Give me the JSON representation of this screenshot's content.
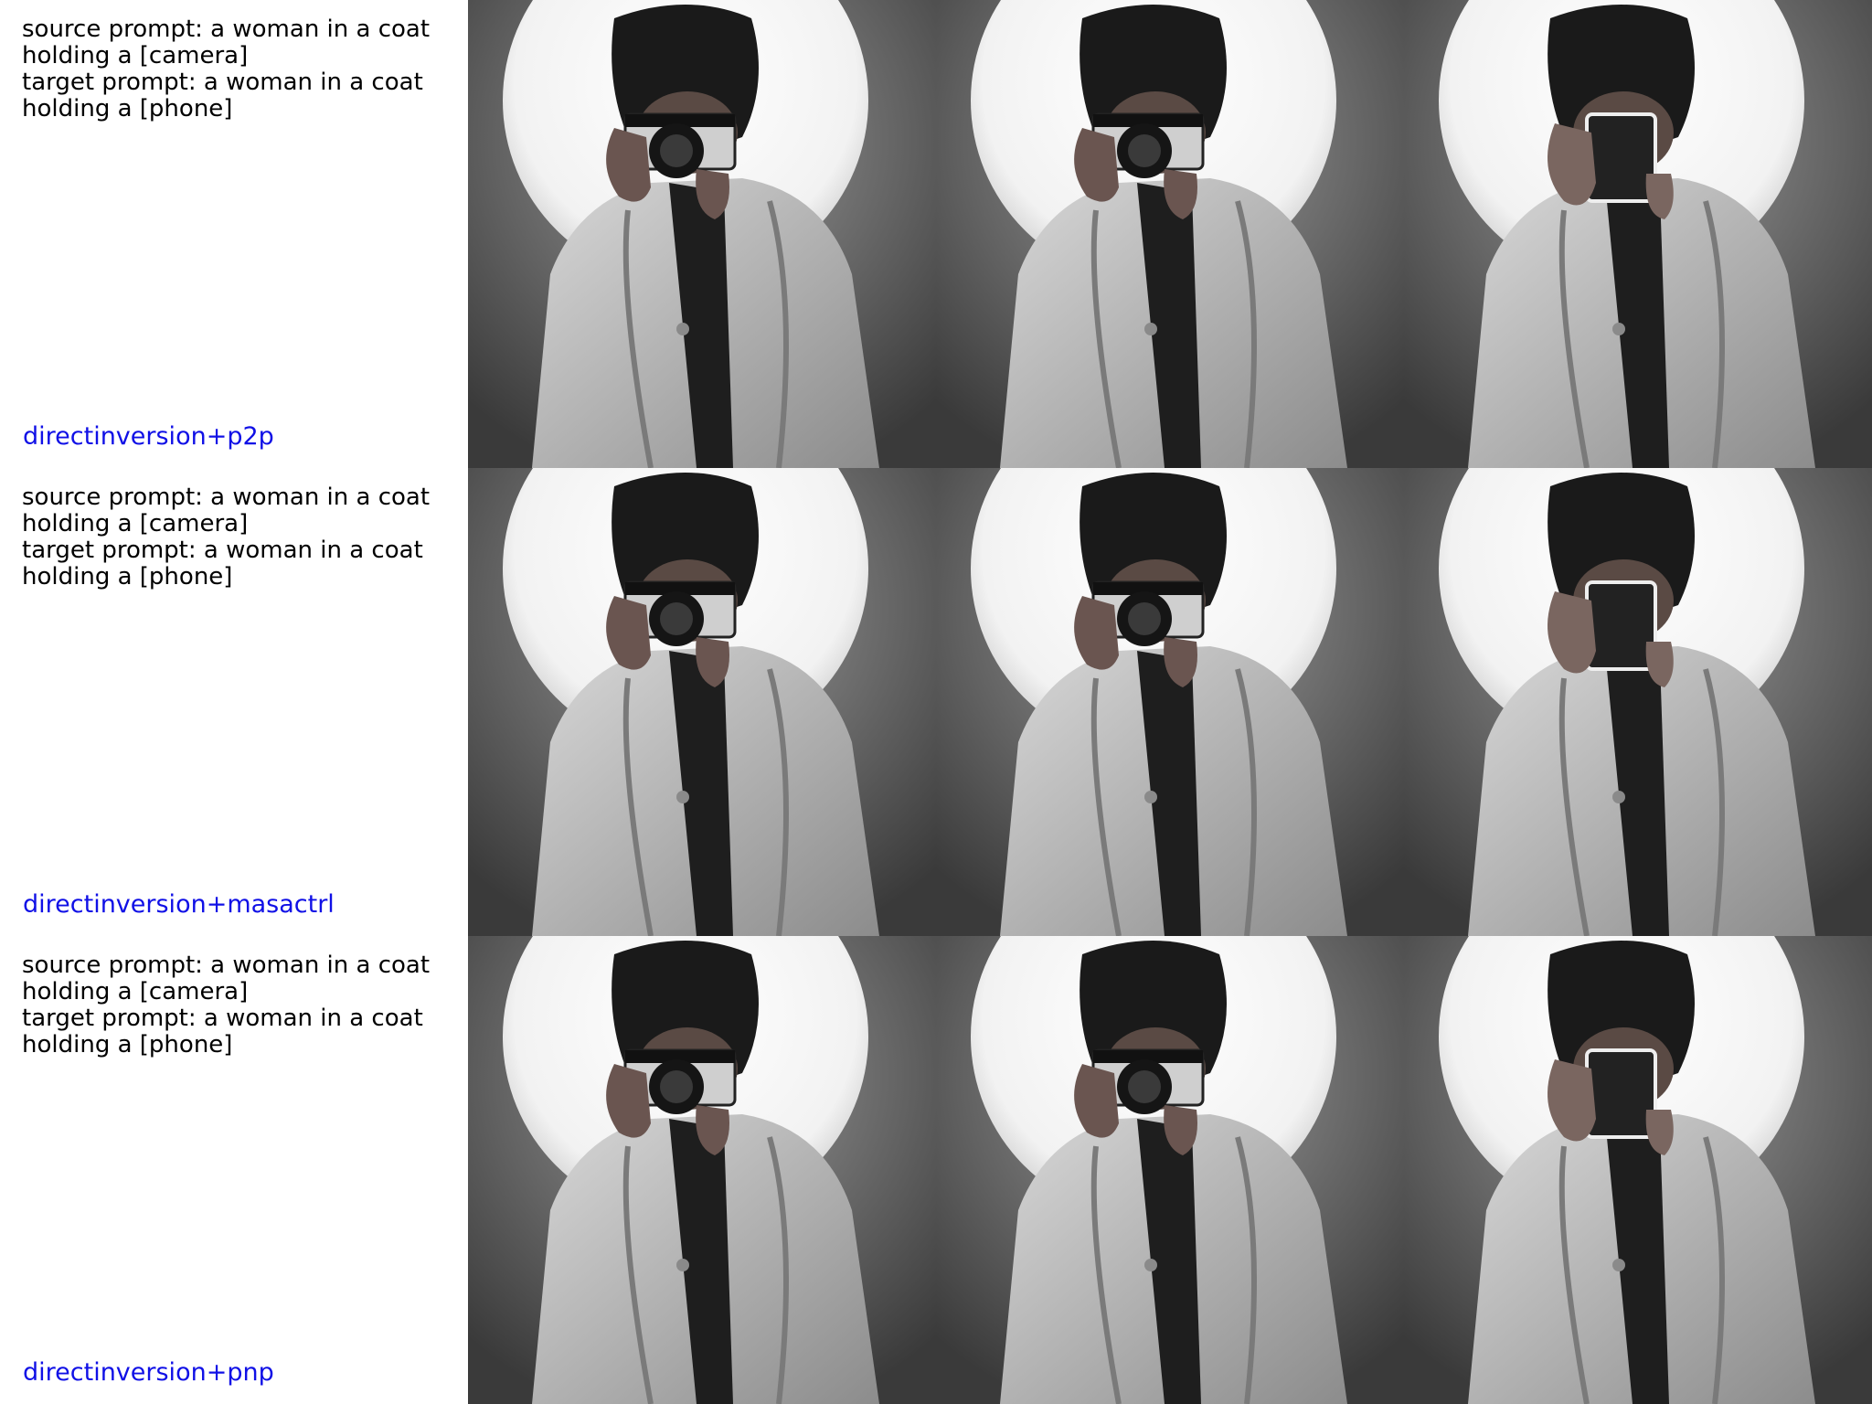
{
  "rows": [
    {
      "prompts": "source prompt: a woman in a coat\nholding a [camera]\ntarget prompt: a woman in a coat\nholding a [phone]",
      "method": "directinversion+p2p",
      "images": [
        "source-image",
        "reconstruction-image",
        "edited-image"
      ]
    },
    {
      "prompts": "source prompt: a woman in a coat\nholding a [camera]\ntarget prompt: a woman in a coat\nholding a [phone]",
      "method": "directinversion+masactrl",
      "images": [
        "source-image",
        "reconstruction-image",
        "edited-image"
      ]
    },
    {
      "prompts": "source prompt: a woman in a coat\nholding a [camera]\ntarget prompt: a woman in a coat\nholding a [phone]",
      "method": "directinversion+pnp",
      "images": [
        "source-image",
        "reconstruction-image",
        "edited-image"
      ]
    }
  ],
  "colors": {
    "method_label": "#1010e6",
    "prompt_text": "#000000"
  }
}
